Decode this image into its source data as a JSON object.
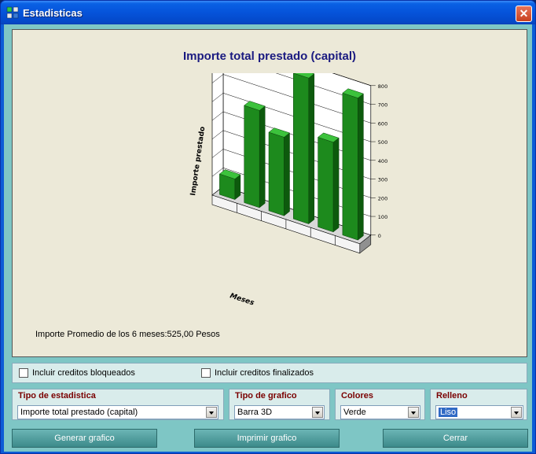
{
  "window": {
    "title": "Estadisticas",
    "close_symbol": "✕"
  },
  "chart_panel": {
    "average_text": "Importe Promedio de los 6 meses:525,00 Pesos"
  },
  "chart_data": {
    "type": "bar",
    "title": "Importe total prestado (capital)",
    "xlabel": "Meses",
    "ylabel": "Importe prestado",
    "ylim": [
      0,
      800
    ],
    "yticks": [
      0,
      100,
      200,
      300,
      400,
      500,
      600,
      700,
      800
    ],
    "categories": [
      "",
      "",
      "",
      "",
      "",
      ""
    ],
    "values": [
      110,
      520,
      420,
      780,
      480,
      760
    ],
    "bar_color": "#1f8f1f",
    "grid": true
  },
  "options": {
    "bloqueados_label": "Incluir creditos bloqueados",
    "bloqueados_checked": false,
    "finalizados_label": "Incluir creditos finalizados",
    "finalizados_checked": false
  },
  "selectors": {
    "tipo_estadistica": {
      "label": "Tipo de estadistica",
      "value": "Importe total prestado (capital)"
    },
    "tipo_grafico": {
      "label": "Tipo de grafico",
      "value": "Barra 3D"
    },
    "colores": {
      "label": "Colores",
      "value": "Verde"
    },
    "relleno": {
      "label": "Relleno",
      "value": "Liso"
    }
  },
  "buttons": {
    "generar": "Generar grafico",
    "imprimir": "Imprimir grafico",
    "cerrar": "Cerrar"
  }
}
